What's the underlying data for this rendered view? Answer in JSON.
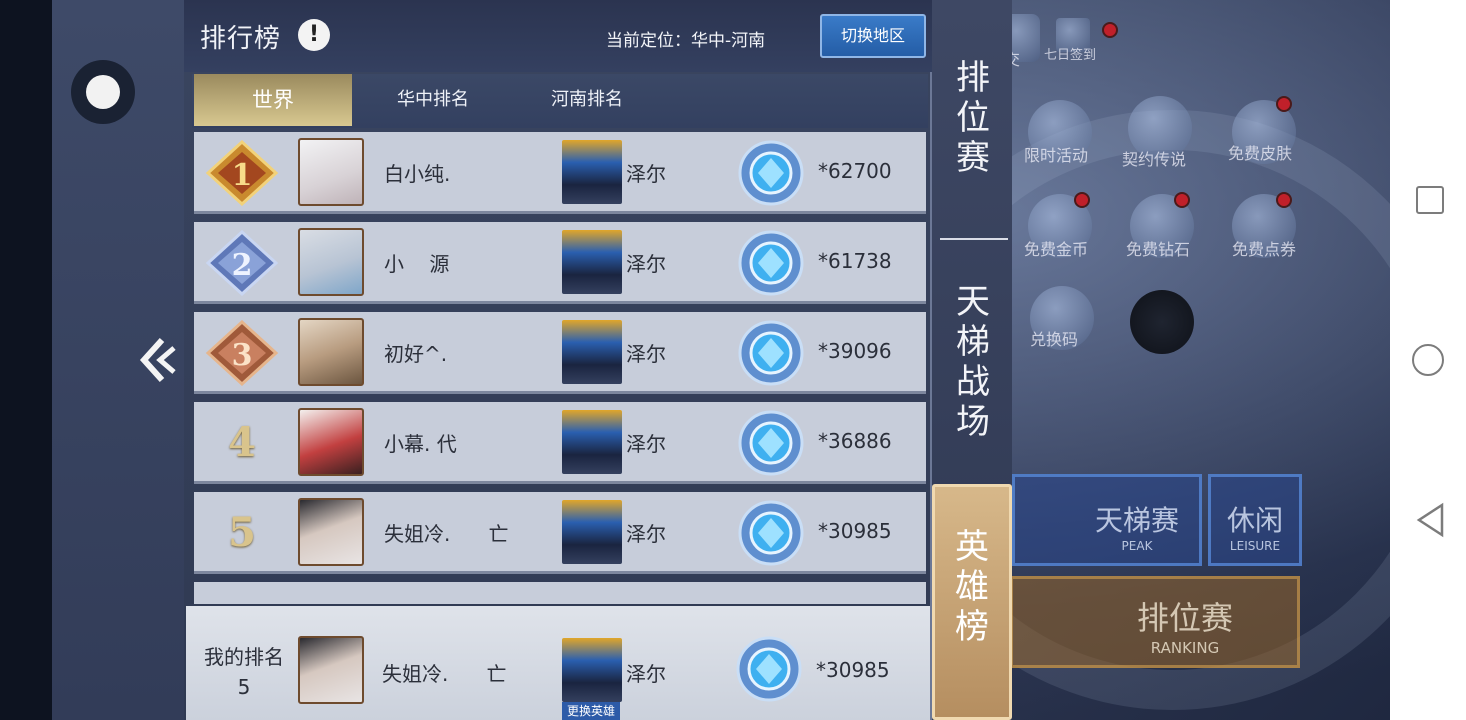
{
  "header": {
    "title": "排行榜",
    "info_icon": "!",
    "location_text": "当前定位：华中-河南",
    "switch_button": "切换地区"
  },
  "tabs": [
    {
      "label": "世界",
      "active": true
    },
    {
      "label": "华中排名",
      "active": false
    },
    {
      "label": "河南排名",
      "active": false
    }
  ],
  "rows": [
    {
      "rank": "1",
      "name": "白小纯.",
      "hero": "泽尔",
      "score": "*62700"
    },
    {
      "rank": "2",
      "name": "小    源",
      "hero": "泽尔",
      "score": "*61738"
    },
    {
      "rank": "3",
      "name": "初好^.",
      "hero": "泽尔",
      "score": "*39096"
    },
    {
      "rank": "4",
      "name": "小幕. 代",
      "hero": "泽尔",
      "score": "*36886"
    },
    {
      "rank": "5",
      "name": "失姐冷.      亡",
      "hero": "泽尔",
      "score": "*30985"
    }
  ],
  "my_rank": {
    "label_line1": "我的排名",
    "label_line2": "5",
    "name": "失姐冷.      亡",
    "hero": "泽尔",
    "score": "*30985",
    "change_hero": "更换英雄"
  },
  "side_tabs": [
    {
      "label": "排位赛",
      "active": false
    },
    {
      "label": "天梯战场",
      "active": false
    },
    {
      "label": "英雄榜",
      "active": true
    }
  ],
  "background_menu": {
    "checkin": "七日签到",
    "limited_event": "限时活动",
    "contract_legend": "契约传说",
    "free_skin": "免费皮肤",
    "free_gold": "免费金币",
    "free_diamond": "免费钻石",
    "free_voucher": "免费点券",
    "redeem_code": "兑换码",
    "peak_label": "天梯赛",
    "peak_sub": "PEAK",
    "leisure_label": "休闲",
    "leisure_sub": "LEISURE",
    "ranking_label": "排位赛",
    "ranking_sub": "RANKING",
    "friend": "交"
  },
  "colors": {
    "active_tab": "#d8c890",
    "switch_button": "#245da6",
    "row_bg": "#c7cdda",
    "hero_tab_active": "#c9a475"
  },
  "icons": {
    "rank1": "gold-medal-icon",
    "rank2": "silver-diamond-icon",
    "rank3": "bronze-diamond-icon",
    "gem": "blue-gem-icon",
    "back": "double-chevron-left-icon"
  }
}
